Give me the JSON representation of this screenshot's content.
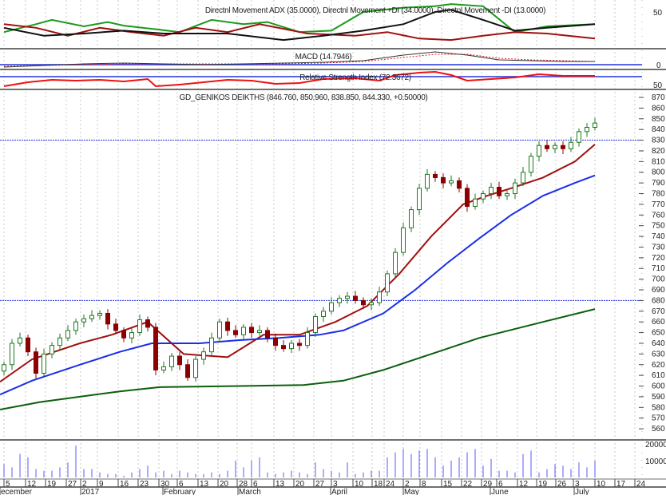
{
  "chart_data": {
    "type": "candlestick",
    "title": "GD_GENIKOS DEIKTHS (846.760, 850.960, 838.850, 844.330, +0.50000)",
    "colors": {
      "up": "#1a7a1a",
      "down": "#8b0000",
      "ma_short": "#a01010",
      "ma_mid": "#1a2ee8",
      "ma_long": "#0b5e0b",
      "hline": "#2233dd",
      "volume": "#5a5aff"
    },
    "ylim": [
      555,
      875
    ],
    "y_ticks": [
      870,
      860,
      850,
      840,
      830,
      820,
      810,
      800,
      790,
      780,
      770,
      760,
      750,
      740,
      730,
      720,
      710,
      700,
      690,
      680,
      670,
      660,
      650,
      640,
      630,
      620,
      610,
      600,
      590,
      580,
      570,
      560
    ],
    "horizontal_lines": [
      830,
      680
    ],
    "close": [
      620,
      640,
      645,
      632,
      612,
      630,
      638,
      645,
      652,
      660,
      663,
      666,
      668,
      658,
      652,
      645,
      650,
      662,
      655,
      615,
      618,
      628,
      620,
      608,
      625,
      632,
      645,
      660,
      652,
      648,
      655,
      650,
      652,
      645,
      638,
      635,
      640,
      638,
      650,
      665,
      670,
      678,
      682,
      684,
      680,
      676,
      678,
      688,
      705,
      725,
      748,
      765,
      785,
      798,
      795,
      790,
      792,
      785,
      768,
      775,
      780,
      786,
      778,
      780,
      790,
      800,
      815,
      825,
      822,
      825,
      822,
      828,
      838,
      842,
      846
    ],
    "moving_averages": [
      {
        "name": "short",
        "points": [
          [
            -0.5,
            604
          ],
          [
            3.5,
            625
          ],
          [
            9.5,
            640
          ],
          [
            13.5,
            648
          ],
          [
            18,
            660
          ],
          [
            22.5,
            630
          ],
          [
            28,
            627
          ],
          [
            32.5,
            648
          ],
          [
            37,
            648
          ],
          [
            41.5,
            660
          ],
          [
            45.5,
            675
          ],
          [
            49.5,
            705
          ],
          [
            53.5,
            740
          ],
          [
            57.5,
            770
          ],
          [
            60.5,
            778
          ],
          [
            63.5,
            785
          ],
          [
            67.5,
            795
          ],
          [
            71.5,
            810
          ],
          [
            74,
            826
          ]
        ]
      },
      {
        "name": "mid",
        "points": [
          [
            -0.5,
            592
          ],
          [
            3.5,
            605
          ],
          [
            9.5,
            620
          ],
          [
            14.5,
            632
          ],
          [
            18.5,
            640
          ],
          [
            24.5,
            640
          ],
          [
            29.5,
            643
          ],
          [
            34.5,
            645
          ],
          [
            39.5,
            648
          ],
          [
            42.5,
            652
          ],
          [
            47.5,
            668
          ],
          [
            51.5,
            690
          ],
          [
            55.5,
            715
          ],
          [
            59.5,
            738
          ],
          [
            63.5,
            760
          ],
          [
            67.5,
            778
          ],
          [
            71.5,
            790
          ],
          [
            74,
            797
          ]
        ]
      },
      {
        "name": "long",
        "points": [
          [
            -0.5,
            578
          ],
          [
            4.5,
            585
          ],
          [
            9.5,
            590
          ],
          [
            14.5,
            595
          ],
          [
            19.5,
            599
          ],
          [
            29.5,
            600
          ],
          [
            37.5,
            601
          ],
          [
            42.5,
            605
          ],
          [
            47.5,
            615
          ],
          [
            53.5,
            630
          ],
          [
            59.5,
            645
          ],
          [
            67.5,
            660
          ],
          [
            74,
            672
          ]
        ]
      }
    ],
    "volume_thousands": [
      8,
      6,
      14,
      12,
      5,
      4,
      4,
      6,
      9,
      19,
      5,
      5,
      3,
      2,
      2,
      1,
      3,
      5,
      7,
      3,
      4,
      2,
      4,
      3,
      2,
      2,
      3,
      2,
      4,
      10,
      6,
      10,
      12,
      3,
      2,
      3,
      4,
      3,
      2,
      9,
      5,
      4,
      3,
      9,
      2,
      3,
      4,
      4,
      12,
      15,
      17,
      14,
      16,
      17,
      12,
      7,
      10,
      12,
      15,
      17,
      7,
      11,
      4,
      4,
      3,
      14,
      16,
      3,
      5,
      8,
      7,
      5,
      9,
      6,
      10
    ],
    "volume_ticks": [
      "20000",
      "10000"
    ],
    "x_dates": [
      "5",
      "12",
      "19",
      "27",
      "2",
      "9",
      "16",
      "23",
      "30",
      "6",
      "13",
      "20",
      "28",
      "6",
      "13",
      "20",
      "27",
      "3",
      "10",
      "18",
      "24",
      "2",
      "8",
      "15",
      "22",
      "29",
      "6",
      "12",
      "19",
      "26",
      "3",
      "10",
      "17",
      "24"
    ],
    "x_months": [
      "ecember",
      "2017",
      "February",
      "March",
      "April",
      "May",
      "June",
      "July"
    ]
  },
  "indicators": {
    "adx": {
      "title": "Directnl Movement ADX (35.0000), Directnl Movement +DI (34.0000), Directnl Movement -DI (13.0000)",
      "tick": "50",
      "plus_di": [
        [
          0,
          22
        ],
        [
          4,
          33
        ],
        [
          6,
          39
        ],
        [
          10,
          30
        ],
        [
          13,
          36
        ],
        [
          15,
          31
        ],
        [
          19,
          26
        ],
        [
          22,
          22
        ],
        [
          26,
          39
        ],
        [
          30,
          33
        ],
        [
          33,
          36
        ],
        [
          37,
          22
        ],
        [
          41,
          24
        ],
        [
          45,
          50
        ],
        [
          50,
          56
        ],
        [
          54,
          58
        ],
        [
          56,
          61
        ],
        [
          60,
          58
        ],
        [
          64,
          22
        ],
        [
          68,
          30
        ],
        [
          74,
          33
        ]
      ],
      "adx": [
        [
          0,
          28
        ],
        [
          5,
          17
        ],
        [
          10,
          20
        ],
        [
          15,
          24
        ],
        [
          20,
          20
        ],
        [
          28,
          20
        ],
        [
          35,
          11
        ],
        [
          40,
          17
        ],
        [
          45,
          24
        ],
        [
          50,
          33
        ],
        [
          54,
          50
        ],
        [
          56,
          53
        ],
        [
          60,
          39
        ],
        [
          64,
          24
        ],
        [
          68,
          28
        ],
        [
          74,
          33
        ]
      ],
      "minus_di": [
        [
          0,
          33
        ],
        [
          4,
          28
        ],
        [
          8,
          17
        ],
        [
          12,
          28
        ],
        [
          16,
          22
        ],
        [
          20,
          17
        ],
        [
          24,
          28
        ],
        [
          28,
          22
        ],
        [
          32,
          33
        ],
        [
          38,
          20
        ],
        [
          44,
          17
        ],
        [
          48,
          22
        ],
        [
          52,
          13
        ],
        [
          56,
          11
        ],
        [
          60,
          17
        ],
        [
          64,
          22
        ],
        [
          68,
          20
        ],
        [
          74,
          13
        ]
      ]
    },
    "macd": {
      "title": "MACD (14.7946)",
      "tick": "0",
      "line": [
        [
          0,
          -3
        ],
        [
          5,
          -1
        ],
        [
          10,
          1
        ],
        [
          15,
          2
        ],
        [
          20,
          1
        ],
        [
          25,
          0
        ],
        [
          30,
          1
        ],
        [
          35,
          2
        ],
        [
          40,
          3
        ],
        [
          45,
          5
        ],
        [
          50,
          12
        ],
        [
          54,
          16
        ],
        [
          58,
          12
        ],
        [
          62,
          6
        ],
        [
          66,
          5
        ],
        [
          70,
          4
        ],
        [
          74,
          4
        ]
      ],
      "signal": [
        [
          0,
          -2
        ],
        [
          5,
          -1
        ],
        [
          10,
          0
        ],
        [
          15,
          1
        ],
        [
          20,
          1
        ],
        [
          25,
          1
        ],
        [
          30,
          1
        ],
        [
          35,
          1
        ],
        [
          40,
          2
        ],
        [
          45,
          4
        ],
        [
          50,
          9
        ],
        [
          54,
          13
        ],
        [
          58,
          13
        ],
        [
          62,
          8
        ],
        [
          66,
          6
        ],
        [
          70,
          5
        ],
        [
          74,
          4
        ]
      ]
    },
    "rsi": {
      "title": "Relative Strength Index (72.3672)",
      "tick": "50",
      "reference": 70,
      "line": [
        [
          0,
          46
        ],
        [
          3,
          56
        ],
        [
          6,
          62
        ],
        [
          9,
          60
        ],
        [
          12,
          62
        ],
        [
          15,
          58
        ],
        [
          18,
          64
        ],
        [
          19,
          46
        ],
        [
          22,
          50
        ],
        [
          25,
          56
        ],
        [
          28,
          62
        ],
        [
          31,
          60
        ],
        [
          34,
          52
        ],
        [
          37,
          54
        ],
        [
          40,
          64
        ],
        [
          44,
          66
        ],
        [
          47,
          60
        ],
        [
          49,
          74
        ],
        [
          52,
          80
        ],
        [
          54,
          82
        ],
        [
          56,
          74
        ],
        [
          58,
          60
        ],
        [
          61,
          64
        ],
        [
          64,
          68
        ],
        [
          67,
          76
        ],
        [
          70,
          72
        ],
        [
          74,
          72
        ]
      ]
    }
  }
}
